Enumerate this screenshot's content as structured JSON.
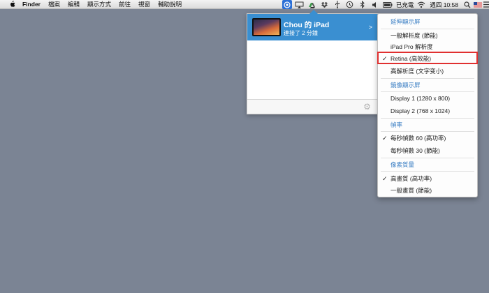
{
  "menubar": {
    "app_name": "Finder",
    "menus": [
      "檔案",
      "編輯",
      "顯示方式",
      "前往",
      "視窗",
      "輔助說明"
    ],
    "battery_text": "已充電",
    "time_text": "週四 10:58"
  },
  "device_panel": {
    "device_name": "Chou 的 iPad",
    "device_status": "連接了 2 分鐘",
    "chevron": ">"
  },
  "dropdown": {
    "sections": [
      {
        "header": "延伸顯示屏",
        "items": [
          {
            "label": "一般解析度 (節能)",
            "checked": false
          },
          {
            "label": "iPad Pro 解析度",
            "checked": false
          },
          {
            "label": "Retina (高效能)",
            "checked": true
          },
          {
            "label": "高解析度 (文字变小)",
            "checked": false
          }
        ]
      },
      {
        "header": "鏡像顯示屏",
        "items": [
          {
            "label": "Display 1 (1280 x 800)",
            "checked": false
          },
          {
            "label": "Display 2 (768 x 1024)",
            "checked": false
          }
        ]
      },
      {
        "header": "幀率",
        "items": [
          {
            "label": "每秒幀數 60 (高功率)",
            "checked": true
          },
          {
            "label": "每秒幀數 30 (節能)",
            "checked": false
          }
        ]
      },
      {
        "header": "像素質量",
        "items": [
          {
            "label": "高畫質 (高功率)",
            "checked": true
          },
          {
            "label": "一般畫質 (節能)",
            "checked": false
          }
        ]
      }
    ],
    "check_glyph": "✓"
  },
  "colors": {
    "desktop": "#7b8494",
    "accent": "#3a8fd1",
    "header_text": "#3b7fc4",
    "highlight": "#e03030"
  }
}
